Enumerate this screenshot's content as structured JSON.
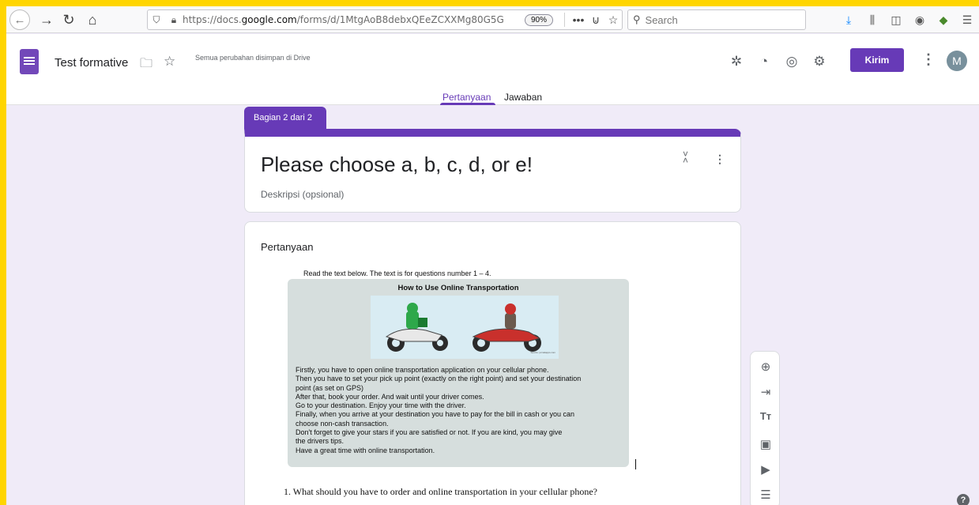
{
  "browser": {
    "url_prefix": "https://docs.",
    "url_domain": "google.com",
    "url_rest": "/forms/d/1MtgAoB8debxQEeZCXXMg80G5G",
    "zoom": "90%",
    "search_placeholder": "Search"
  },
  "header": {
    "form_title": "Test formative",
    "saved_status": "Semua perubahan disimpan di Drive",
    "send_label": "Kirim",
    "avatar_initial": "M"
  },
  "tabs": {
    "questions": "Pertanyaan",
    "responses": "Jawaban"
  },
  "section": {
    "tag": "Bagian 2 dari 2",
    "title": "Please choose a, b, c, d, or e!",
    "description_placeholder": "Deskripsi (opsional)"
  },
  "question": {
    "label": "Pertanyaan",
    "reading_intro": "Read the text below. The text is for questions number 1 – 4.",
    "reading_title": "How to Use Online Transportation",
    "image_source": "Source: jurnalapps.com",
    "reading_lines": [
      "Firstly, you have to open online transportation application on your cellular phone.",
      "Then you have to set your pick up point (exactly on the right point) and set your destination",
      "point (as set on GPS)",
      "After that, book your order. And wait until your driver comes.",
      "Go to your destination. Enjoy your time with the driver.",
      "Finally, when you arrive at your destination you have to pay for the bill in cash or you can",
      "choose non-cash transaction.",
      "Don't forget to give your stars if you are satisfied or not. If you are kind, you may give",
      "the drivers tips.",
      "Have a great time with online transportation."
    ],
    "q1_text": "1.   What should you have to order and online transportation in your cellular phone?"
  },
  "colors": {
    "accent": "#673ab7",
    "background": "#f0ebf8",
    "frame": "#ffd500"
  }
}
